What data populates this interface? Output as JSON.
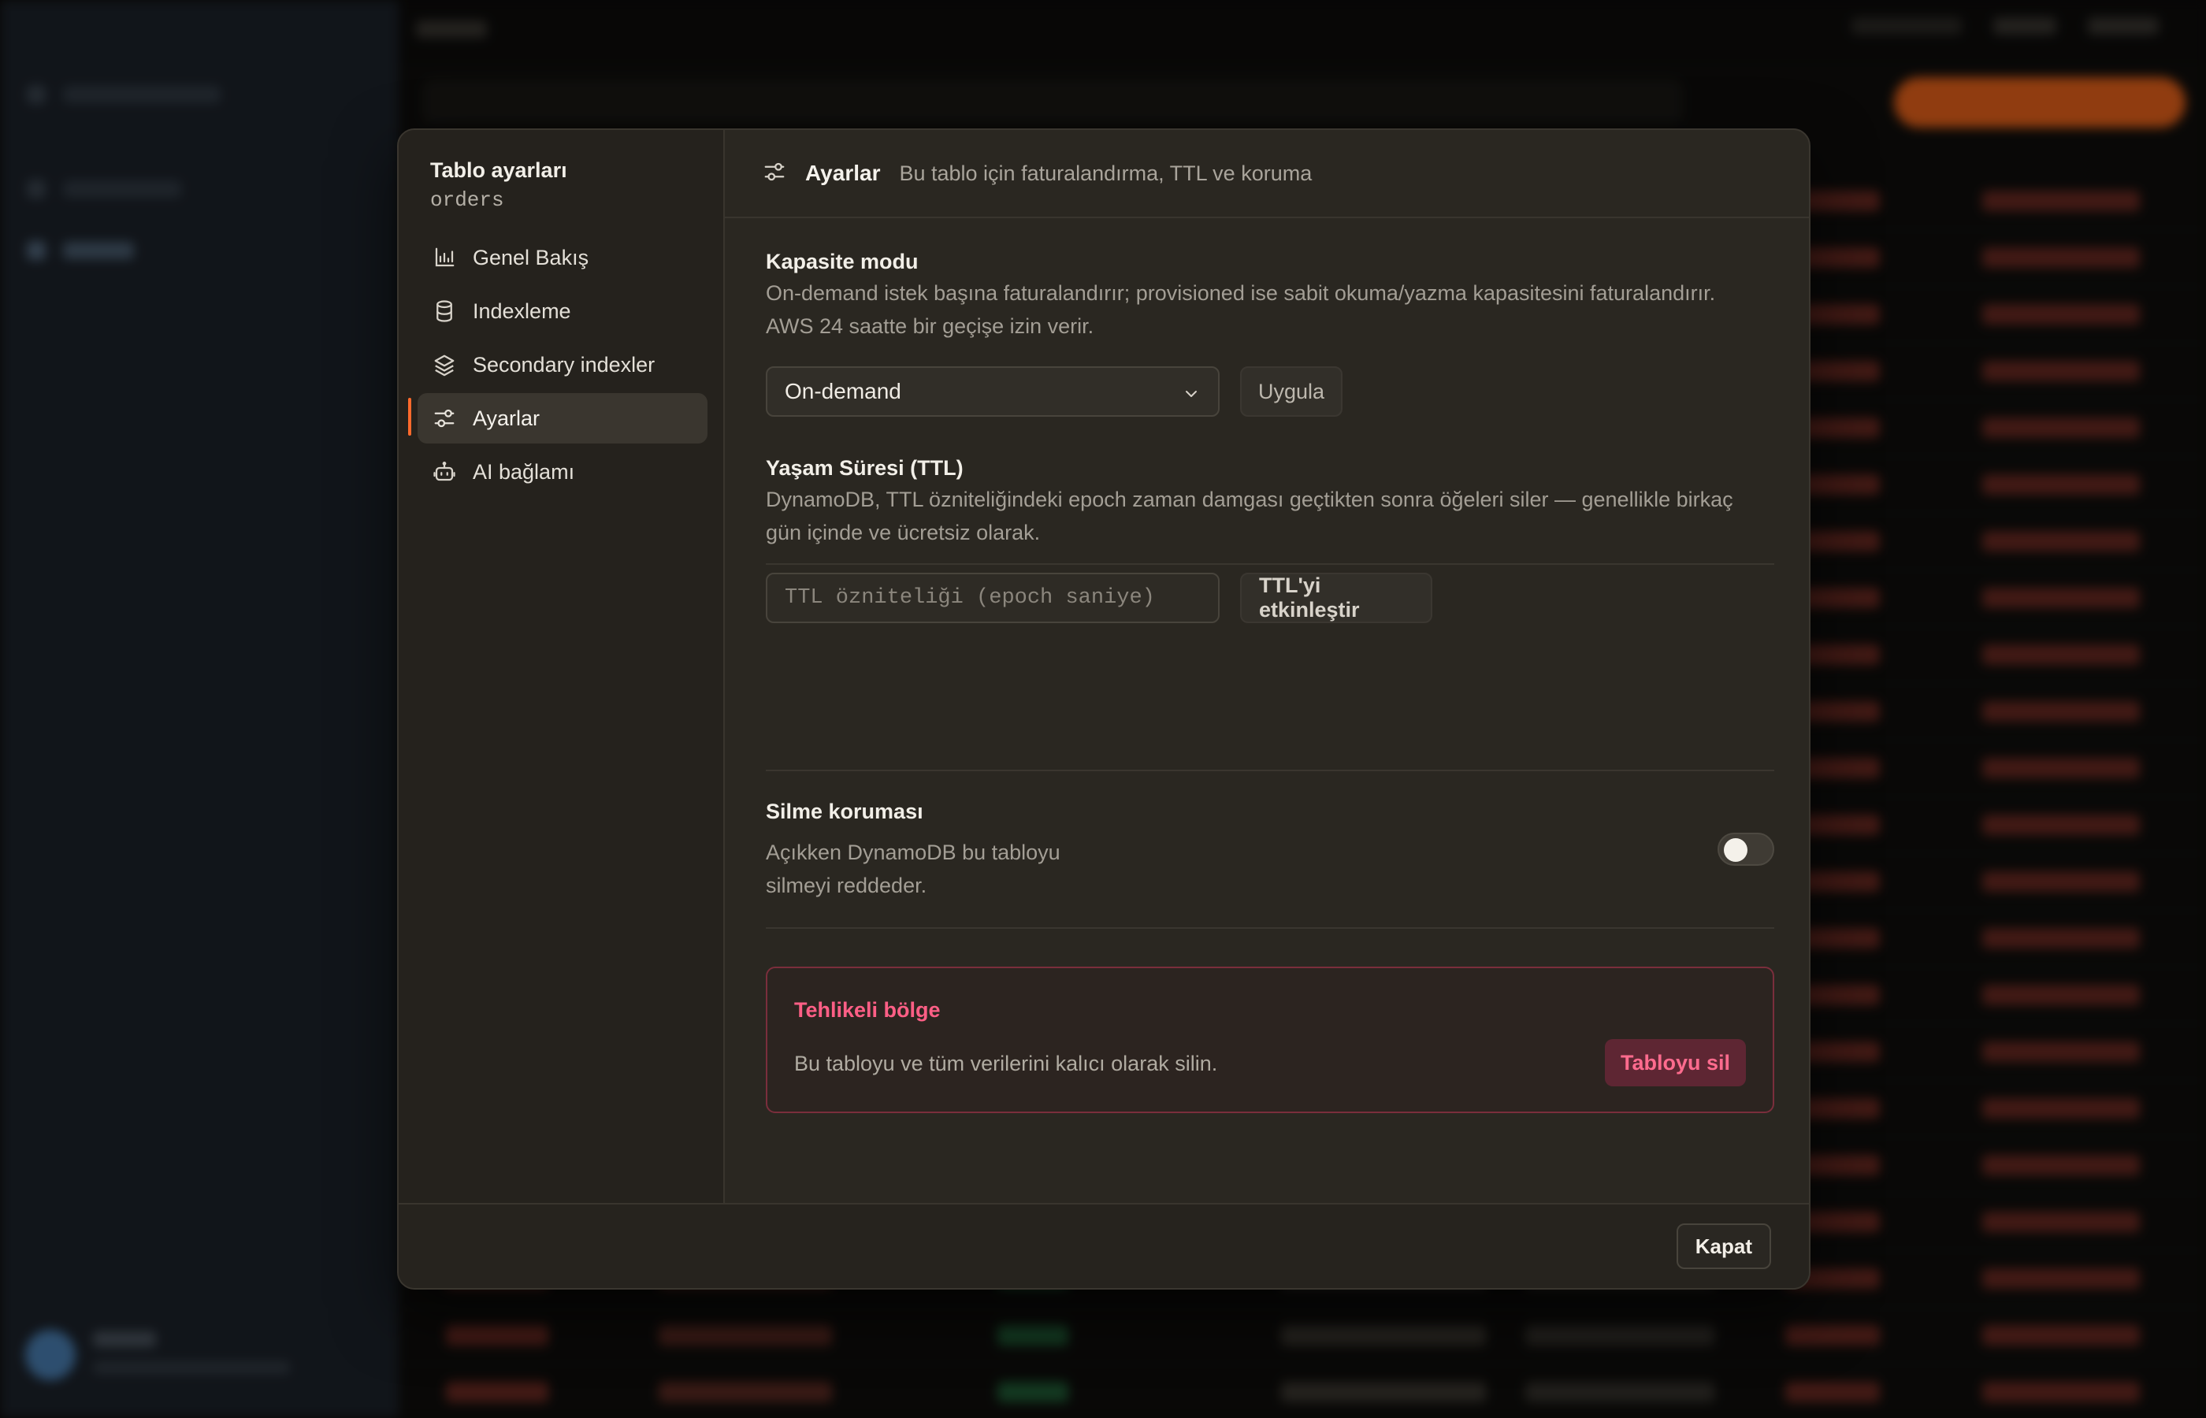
{
  "modal": {
    "nav_title": "Tablo ayarları",
    "nav_subtitle": "orders",
    "nav_items": [
      {
        "label": "Genel Bakış",
        "icon": "bar-chart-icon"
      },
      {
        "label": "Indexleme",
        "icon": "database-icon"
      },
      {
        "label": "Secondary indexler",
        "icon": "layers-icon"
      },
      {
        "label": "Ayarlar",
        "icon": "sliders-icon",
        "active": true
      },
      {
        "label": "AI bağlamı",
        "icon": "robot-icon"
      }
    ],
    "header": {
      "title": "Ayarlar",
      "description": "Bu tablo için faturalandırma, TTL ve koruma"
    },
    "capacity": {
      "title": "Kapasite modu",
      "description_line1": "On-demand istek başına faturalandırır; provisioned ise sabit okuma/yazma kapasitesini faturalandırır.",
      "description_line2": "AWS 24 saatte bir geçişe izin verir.",
      "selected": "On-demand",
      "apply_label": "Uygula"
    },
    "ttl": {
      "title": "Yaşam Süresi (TTL)",
      "description_line1": "DynamoDB, TTL özniteliğindeki epoch zaman damgası geçtikten sonra öğeleri siler — genellikle birkaç",
      "description_line2": "gün içinde ve ücretsiz olarak.",
      "placeholder": "TTL özniteliği (epoch saniye)",
      "enable_label": "TTL'yi etkinleştir"
    },
    "deletion_protection": {
      "title": "Silme koruması",
      "description_line1": "Açıkken DynamoDB bu tabloyu",
      "description_line2": "silmeyi reddeder.",
      "enabled": false
    },
    "danger_zone": {
      "title": "Tehlikeli bölge",
      "description": "Bu tabloyu ve tüm verilerini kalıcı olarak silin.",
      "delete_label": "Tabloyu sil"
    },
    "close_label": "Kapat"
  },
  "colors": {
    "accent": "#ff6a2c",
    "danger": "#ff5f86",
    "modal_bg": "#2a2721"
  }
}
